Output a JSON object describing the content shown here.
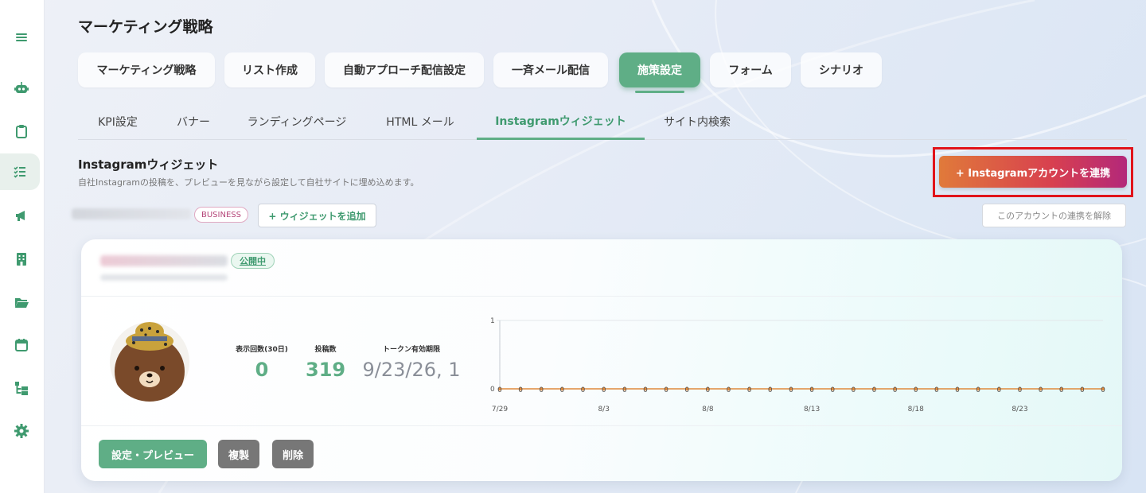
{
  "page_title": "マーケティング戦略",
  "main_tabs": [
    {
      "label": "マーケティング戦略"
    },
    {
      "label": "リスト作成"
    },
    {
      "label": "自動アプローチ配信設定"
    },
    {
      "label": "一斉メール配信"
    },
    {
      "label": "施策設定"
    },
    {
      "label": "フォーム"
    },
    {
      "label": "シナリオ"
    }
  ],
  "sub_tabs": [
    {
      "label": "KPI設定"
    },
    {
      "label": "バナー"
    },
    {
      "label": "ランディングページ"
    },
    {
      "label": "HTML メール"
    },
    {
      "label": "Instagramウィジェット"
    },
    {
      "label": "サイト内検索"
    }
  ],
  "section": {
    "title": "Instagramウィジェット",
    "description": "自社Instagramの投稿を、プレビューを見ながら設定して自社サイトに埋め込めます。"
  },
  "actions": {
    "connect_label": "+ Instagramアカウントを連携",
    "business_badge": "BUSINESS",
    "add_widget_label": "+ ウィジェットを追加",
    "disconnect_label": "このアカウントの連携を解除"
  },
  "widget": {
    "status": "公開中",
    "stats": [
      {
        "label": "表示回数(30日)",
        "value": "0"
      },
      {
        "label": "投稿数",
        "value": "319"
      },
      {
        "label": "トークン有効期限",
        "value": "9/23/26, 1"
      }
    ],
    "buttons": {
      "settings": "設定・プレビュー",
      "duplicate": "複製",
      "delete": "削除"
    }
  },
  "chart_data": {
    "type": "line",
    "ylim": [
      0,
      1
    ],
    "y_ticks": [
      "1",
      "0"
    ],
    "x_tick_labels": [
      "7/29",
      "8/3",
      "8/8",
      "8/13",
      "8/18",
      "8/23"
    ],
    "point_count": 30,
    "series": [
      {
        "values": [
          0,
          0,
          0,
          0,
          0,
          0,
          0,
          0,
          0,
          0,
          0,
          0,
          0,
          0,
          0,
          0,
          0,
          0,
          0,
          0,
          0,
          0,
          0,
          0,
          0,
          0,
          0,
          0,
          0,
          0
        ],
        "color": "#e08a3c"
      }
    ],
    "grid": true
  },
  "colors": {
    "accent_green": "#5fae86",
    "connect_gradient_start": "#e07a3a",
    "connect_gradient_end": "#b3287a",
    "highlight_red": "#e1141b"
  },
  "sidebar_icons": [
    "menu-icon",
    "robot-icon",
    "clipboard-icon",
    "checklist-icon",
    "megaphone-icon",
    "building-icon",
    "folder-open-icon",
    "calendar-icon",
    "sitemap-icon",
    "gear-icon"
  ]
}
